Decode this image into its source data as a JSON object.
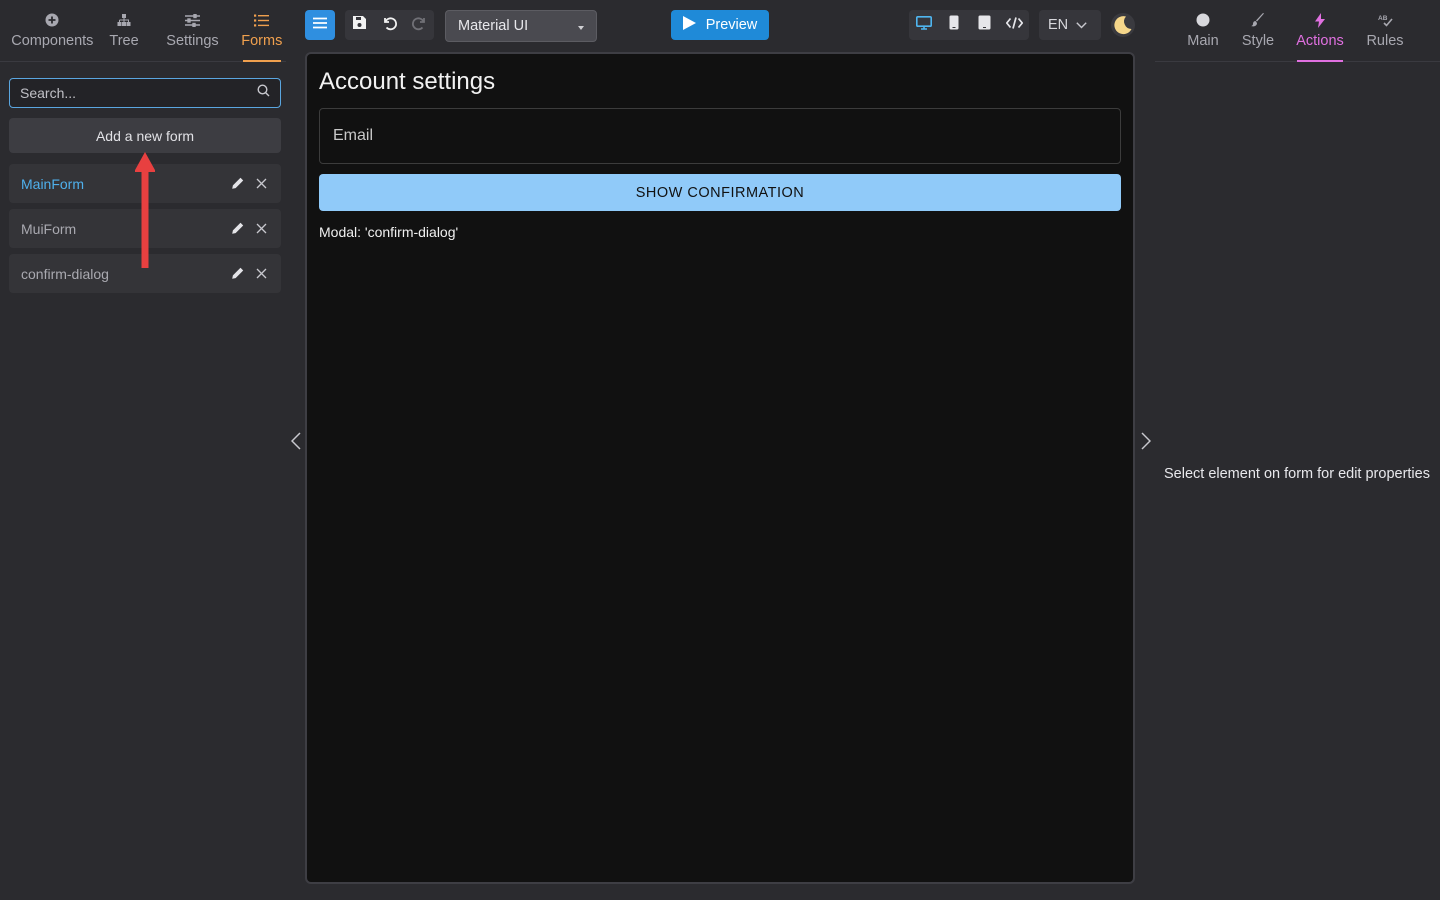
{
  "left_panel": {
    "tabs": [
      {
        "label": "Components",
        "icon": "plus-circle-icon"
      },
      {
        "label": "Tree",
        "icon": "tree-icon"
      },
      {
        "label": "Settings",
        "icon": "sliders-icon"
      },
      {
        "label": "Forms",
        "icon": "list-icon",
        "active": true
      }
    ],
    "search_placeholder": "Search...",
    "add_form_label": "Add a new form",
    "forms": [
      {
        "name": "MainForm",
        "active": true
      },
      {
        "name": "MuiForm",
        "active": false
      },
      {
        "name": "confirm-dialog",
        "active": false
      }
    ]
  },
  "toolbar": {
    "ui_library": "Material UI",
    "preview_label": "Preview",
    "language": "EN"
  },
  "canvas": {
    "title": "Account settings",
    "email_placeholder": "Email",
    "button_label": "SHOW CONFIRMATION",
    "modal_label": "Modal: 'confirm-dialog'"
  },
  "right_panel": {
    "tabs": [
      {
        "label": "Main",
        "icon": "circle-icon"
      },
      {
        "label": "Style",
        "icon": "brush-icon"
      },
      {
        "label": "Actions",
        "icon": "lightning-icon",
        "active": true
      },
      {
        "label": "Rules",
        "icon": "spellcheck-icon"
      }
    ],
    "hint": "Select element on form for edit properties"
  },
  "colors": {
    "accent_blue": "#2f8fe0",
    "forms_tab_active": "#f0a04e",
    "actions_tab_active": "#e070e0",
    "button_light_blue": "#90caf9",
    "annotation_arrow": "#e84040"
  }
}
